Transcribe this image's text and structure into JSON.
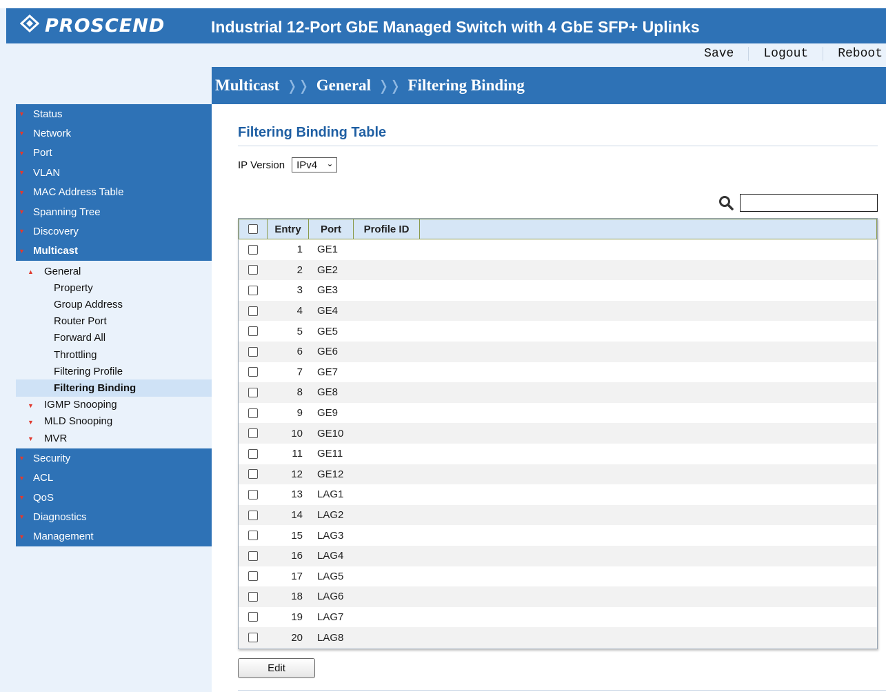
{
  "brand": {
    "logo_text": "PROSCEND"
  },
  "header": {
    "title": "Industrial 12-Port GbE Managed Switch with 4 GbE SFP+ Uplinks"
  },
  "actions": {
    "save": "Save",
    "logout": "Logout",
    "reboot": "Reboot"
  },
  "breadcrumb": [
    "Multicast",
    "General",
    "Filtering Binding"
  ],
  "sidebar": {
    "top_items": [
      "Status",
      "Network",
      "Port",
      "VLAN",
      "MAC Address Table",
      "Spanning Tree",
      "Discovery",
      "Multicast"
    ],
    "multicast_sub": {
      "general": "General",
      "general_items": [
        "Property",
        "Group Address",
        "Router Port",
        "Forward All",
        "Throttling",
        "Filtering Profile",
        "Filtering Binding"
      ],
      "others": [
        "IGMP Snooping",
        "MLD Snooping",
        "MVR"
      ]
    },
    "bottom_items": [
      "Security",
      "ACL",
      "QoS",
      "Diagnostics",
      "Management"
    ]
  },
  "page": {
    "title": "Filtering Binding Table",
    "ip_version_label": "IP Version",
    "ip_version_value": "IPv4"
  },
  "table": {
    "headers": [
      "Entry",
      "Port",
      "Profile ID"
    ],
    "rows": [
      {
        "entry": "1",
        "port": "GE1"
      },
      {
        "entry": "2",
        "port": "GE2"
      },
      {
        "entry": "3",
        "port": "GE3"
      },
      {
        "entry": "4",
        "port": "GE4"
      },
      {
        "entry": "5",
        "port": "GE5"
      },
      {
        "entry": "6",
        "port": "GE6"
      },
      {
        "entry": "7",
        "port": "GE7"
      },
      {
        "entry": "8",
        "port": "GE8"
      },
      {
        "entry": "9",
        "port": "GE9"
      },
      {
        "entry": "10",
        "port": "GE10"
      },
      {
        "entry": "11",
        "port": "GE11"
      },
      {
        "entry": "12",
        "port": "GE12"
      },
      {
        "entry": "13",
        "port": "LAG1"
      },
      {
        "entry": "14",
        "port": "LAG2"
      },
      {
        "entry": "15",
        "port": "LAG3"
      },
      {
        "entry": "16",
        "port": "LAG4"
      },
      {
        "entry": "17",
        "port": "LAG5"
      },
      {
        "entry": "18",
        "port": "LAG6"
      },
      {
        "entry": "19",
        "port": "LAG7"
      },
      {
        "entry": "20",
        "port": "LAG8"
      }
    ]
  },
  "buttons": {
    "edit": "Edit"
  },
  "colors": {
    "brand_blue": "#2e72b6",
    "light_bg": "#eaf2fb",
    "title_blue": "#1f5fa3",
    "caret_red": "#e03a2f",
    "selected_bg": "#cfe2f6"
  }
}
